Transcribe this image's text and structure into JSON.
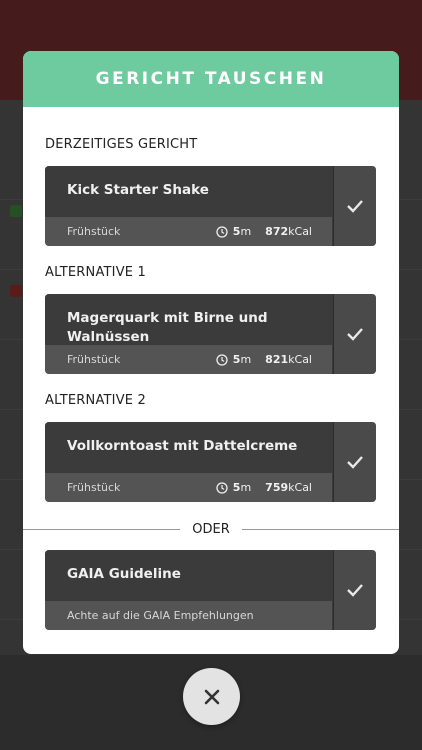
{
  "modal": {
    "title": "GERICHT TAUSCHEN",
    "sections": [
      {
        "label": "DERZEITIGES GERICHT",
        "card": {
          "title": "Kick Starter Shake",
          "category": "Frühstück",
          "time_value": "5",
          "time_unit": "m",
          "kcal_value": "872",
          "kcal_unit": "kCal"
        }
      },
      {
        "label": "ALTERNATIVE 1",
        "card": {
          "title": "Magerquark mit Birne und Walnüssen",
          "category": "Frühstück",
          "time_value": "5",
          "time_unit": "m",
          "kcal_value": "821",
          "kcal_unit": "kCal"
        }
      },
      {
        "label": "ALTERNATIVE 2",
        "card": {
          "title": "Vollkorntoast mit Dattelcreme",
          "category": "Frühstück",
          "time_value": "5",
          "time_unit": "m",
          "kcal_value": "759",
          "kcal_unit": "kCal"
        }
      }
    ],
    "divider_label": "ODER",
    "guideline_card": {
      "title": "GAIA Guideline",
      "subtitle": "Achte auf die GAIA Empfehlungen"
    }
  },
  "icons": {
    "check": "check-icon",
    "clock": "clock-icon",
    "close": "close-icon"
  },
  "colors": {
    "header_green": "#6ecb9f",
    "card_dark": "#3b3b3b",
    "card_bottom": "#545454"
  }
}
